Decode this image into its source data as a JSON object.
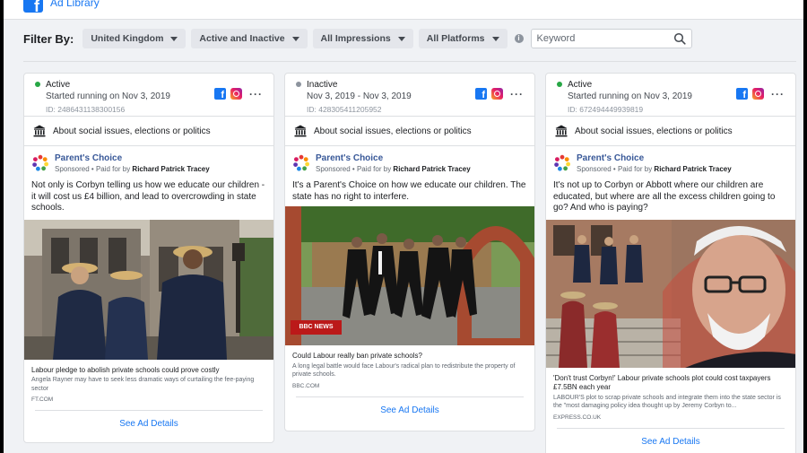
{
  "app": {
    "title": "Ad Library"
  },
  "filter": {
    "label": "Filter By:",
    "country": "United Kingdom",
    "status": "Active and Inactive",
    "impressions": "All Impressions",
    "platforms": "All Platforms",
    "search_placeholder": "Keyword"
  },
  "colors": {
    "active": "#27a745",
    "inactive": "#8d949e",
    "link": "#1877f2"
  },
  "cards": [
    {
      "status": "Active",
      "running": "Started running on Nov 3, 2019",
      "id": "ID: 2486431138300156",
      "about": "About social issues, elections or politics",
      "advertiser": "Parent's Choice",
      "sponsored": "Sponsored",
      "paid_prefix": " • Paid for by ",
      "paid_by": "Richard Patrick Tracey",
      "text": "Not only is Corbyn telling us how we educate our children - it will cost us £4 billion, and lead to overcrowding in state schools.",
      "link_title": "Labour pledge to abolish private schools could prove costly",
      "link_desc": "Angela Rayner may have to seek less dramatic ways of curtailing the fee-paying sector",
      "link_domain": "FT.COM",
      "see_details": "See Ad Details"
    },
    {
      "status": "Inactive",
      "running": "Nov 3, 2019 - Nov 3, 2019",
      "id": "ID: 428305411205952",
      "about": "About social issues, elections or politics",
      "advertiser": "Parent's Choice",
      "sponsored": "Sponsored",
      "paid_prefix": " • Paid for by ",
      "paid_by": "Richard Patrick Tracey",
      "text": "It's a Parent's Choice on how we educate our children. The state has no right to interfere.",
      "image_badge": "BBC NEWS",
      "link_title": "Could Labour really ban private schools?",
      "link_desc": "A long legal battle would face Labour's radical plan to redistribute the property of private schools.",
      "link_domain": "BBC.COM",
      "see_details": "See Ad Details"
    },
    {
      "status": "Active",
      "running": "Started running on Nov 3, 2019",
      "id": "ID: 672494449939819",
      "about": "About social issues, elections or politics",
      "advertiser": "Parent's Choice",
      "sponsored": "Sponsored",
      "paid_prefix": " • Paid for by ",
      "paid_by": "Richard Patrick Tracey",
      "text": "It's not up to Corbyn or Abbott where our children are educated, but where are all the excess children going to go? And who is paying?",
      "link_title": "'Don't trust Corbyn!' Labour private schools plot could cost taxpayers £7.5BN each year",
      "link_desc": "LABOUR'S plot to scrap private schools and integrate them into the state sector is the \"most damaging policy idea thought up by Jeremy Corbyn to...",
      "link_domain": "EXPRESS.CO.UK",
      "see_details": "See Ad Details"
    }
  ]
}
